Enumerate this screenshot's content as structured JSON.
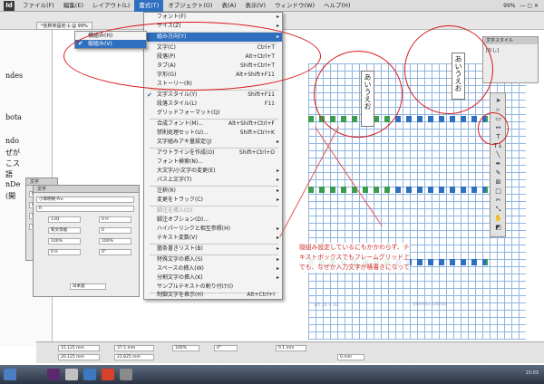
{
  "app": {
    "icon_label": "Id"
  },
  "menubar": {
    "items": [
      "ファイル(F)",
      "編集(E)",
      "レイアウト(L)",
      "書式(T)",
      "オブジェクト(O)",
      "表(A)",
      "表示(V)",
      "ウィンドウ(W)",
      "ヘルプ(H)"
    ],
    "zoom": "99%"
  },
  "doc_tab": "*名称未設定-1 @ 99%",
  "left_fragments": [
    "ndes",
    "bota",
    "ndo",
    "ぜが",
    "こス",
    "語",
    "nDe",
    "(開"
  ],
  "format_menu": [
    {
      "label": "フォント(F)",
      "shortcut": "",
      "sub": true
    },
    {
      "label": "サイズ(Z)",
      "shortcut": "",
      "sub": true
    },
    {
      "label": "組み方向(Y)",
      "shortcut": "",
      "sub": true,
      "highlight": true
    },
    {
      "label": "文字(C)",
      "shortcut": "Ctrl+T"
    },
    {
      "label": "段落(P)",
      "shortcut": "Alt+Ctrl+T"
    },
    {
      "label": "タブ(A)",
      "shortcut": "Shift+Ctrl+T"
    },
    {
      "label": "字形(G)",
      "shortcut": "Alt+Shift+F11"
    },
    {
      "label": "ストーリー(R)",
      "shortcut": ""
    },
    {
      "label": "文字スタイル(Y)",
      "shortcut": "Shift+F11",
      "checked": true
    },
    {
      "label": "段落スタイル(L)",
      "shortcut": "F11"
    },
    {
      "label": "グリッドフォーマット(Q)",
      "shortcut": ""
    },
    {
      "label": "合成フォント(M)...",
      "shortcut": "Alt+Shift+Ctrl+F"
    },
    {
      "label": "禁則処理セット(U)...",
      "shortcut": "Shift+Ctrl+K"
    },
    {
      "label": "文字組みアキ量設定(J)",
      "shortcut": "",
      "sub": true
    },
    {
      "label": "アウトラインを作成(O)",
      "shortcut": "Shift+Ctrl+O"
    },
    {
      "label": "フォント検索(N)...",
      "shortcut": ""
    },
    {
      "label": "大文字/小文字の変更(E)",
      "shortcut": "",
      "sub": true
    },
    {
      "label": "パス上文字(T)",
      "shortcut": "",
      "sub": true
    },
    {
      "label": "注釈(R)",
      "shortcut": "",
      "sub": true
    },
    {
      "label": "変更をトラック(C)",
      "shortcut": "",
      "sub": true
    },
    {
      "label": "脚注を挿入(O)",
      "shortcut": "",
      "disabled": true
    },
    {
      "label": "脚注オプション(D)...",
      "shortcut": ""
    },
    {
      "label": "ハイパーリンクと相互参照(H)",
      "shortcut": "",
      "sub": true
    },
    {
      "label": "テキスト変数(V)",
      "shortcut": "",
      "sub": true
    },
    {
      "label": "箇条書きリスト(B)",
      "shortcut": "",
      "sub": true
    },
    {
      "label": "特殊文字の挿入(S)",
      "shortcut": "",
      "sub": true
    },
    {
      "label": "スペースの挿入(W)",
      "shortcut": "",
      "sub": true
    },
    {
      "label": "分割文字の挿入(K)",
      "shortcut": "",
      "sub": true
    },
    {
      "label": "サンプルテキストの割り付け(I)",
      "shortcut": ""
    },
    {
      "label": "制御文字を表示(H)",
      "shortcut": "Alt+Ctrl+I"
    }
  ],
  "submenu": [
    {
      "label": "横組み(H)",
      "checked": false
    },
    {
      "label": "縦組み(V)",
      "checked": true,
      "highlight": true
    }
  ],
  "canvas": {
    "frame1_text": "あいうえお",
    "frame2_text": "あいうえお",
    "grid_label": "J/W/H/Ls 13Q(Q)",
    "grid_label2": "1行 20 × 20"
  },
  "annotation": "縦組み設定しているにもかかわらず、テキストボックスでもフレームグリッド上でも、なぜか入力文字が横書きになって",
  "char_panel": {
    "title": "文字",
    "font": "小塚明朝 Pro",
    "style": "R",
    "size": "13Q",
    "leading": "0 H",
    "kerning": "和文等幅",
    "tracking": "0",
    "scale_v": "100%",
    "scale_h": "100%",
    "baseline": "0 H",
    "rotation": "0°",
    "language": "日本語"
  },
  "small_panel": {
    "title": "文字",
    "rows": [
      "0 mm",
      "0 mm",
      "自動",
      "自動"
    ]
  },
  "styles_panel": {
    "title": "文字スタイル",
    "item": "[なし]"
  },
  "tool_icons": [
    "selection-icon",
    "direct-selection-icon",
    "page-icon",
    "gap-icon",
    "type-icon",
    "vertical-type-icon",
    "line-icon",
    "pen-icon",
    "pencil-icon",
    "rectangle-frame-icon",
    "rectangle-icon",
    "scissors-icon",
    "transform-icon",
    "gradient-icon",
    "note-icon",
    "eyedropper-icon",
    "hand-icon",
    "zoom-icon",
    "fill-stroke-icon"
  ],
  "bottom_bar": {
    "x": "15.125 mm",
    "y": "20.125 mm",
    "w": "37.5 mm",
    "h": "21.625 mm",
    "scale": "100%",
    "angle": "0°",
    "stroke": "0.1 mm",
    "zoom": "0 mm"
  },
  "taskbar": {
    "time": "15:03"
  }
}
